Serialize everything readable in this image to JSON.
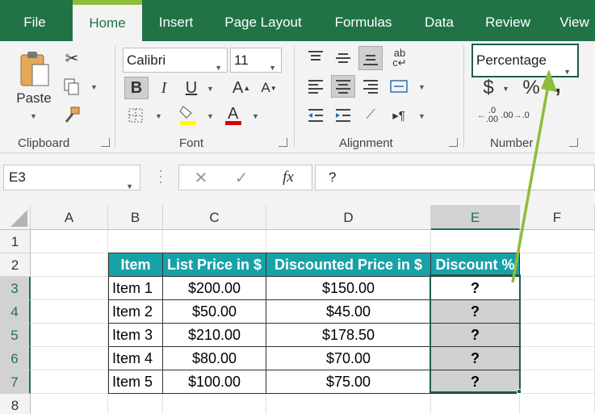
{
  "tabs": [
    "File",
    "Home",
    "Insert",
    "Page Layout",
    "Formulas",
    "Data",
    "Review",
    "View"
  ],
  "active_tab": "Home",
  "accent_color": "#217346",
  "table_header_color": "#17a2a7",
  "clipboard": {
    "paste_label": "Paste",
    "group_label": "Clipboard"
  },
  "font": {
    "name": "Calibri",
    "size": "11",
    "group_label": "Font",
    "bold": "B",
    "italic": "I",
    "underline": "U"
  },
  "alignment": {
    "group_label": "Alignment"
  },
  "number": {
    "format": "Percentage",
    "group_label": "Number",
    "currency": "$",
    "percent": "%",
    "comma": ","
  },
  "formula_bar": {
    "name_box": "E3",
    "cancel": "✕",
    "enter": "✓",
    "fx": "fx",
    "content": "?"
  },
  "columns": [
    "A",
    "B",
    "C",
    "D",
    "E",
    "F"
  ],
  "selected_column": "E",
  "rows": [
    "1",
    "2",
    "3",
    "4",
    "5",
    "6",
    "7",
    "8"
  ],
  "selected_rows": [
    "3",
    "4",
    "5",
    "6",
    "7"
  ],
  "table": {
    "headers": [
      "Item",
      "List Price in $",
      "Discounted Price in $",
      "Discount %"
    ],
    "rows": [
      [
        "Item 1",
        "$200.00",
        "$150.00",
        "?"
      ],
      [
        "Item 2",
        "$50.00",
        "$45.00",
        "?"
      ],
      [
        "Item 3",
        "$210.00",
        "$178.50",
        "?"
      ],
      [
        "Item 4",
        "$80.00",
        "$70.00",
        "?"
      ],
      [
        "Item 5",
        "$100.00",
        "$75.00",
        "?"
      ]
    ]
  }
}
